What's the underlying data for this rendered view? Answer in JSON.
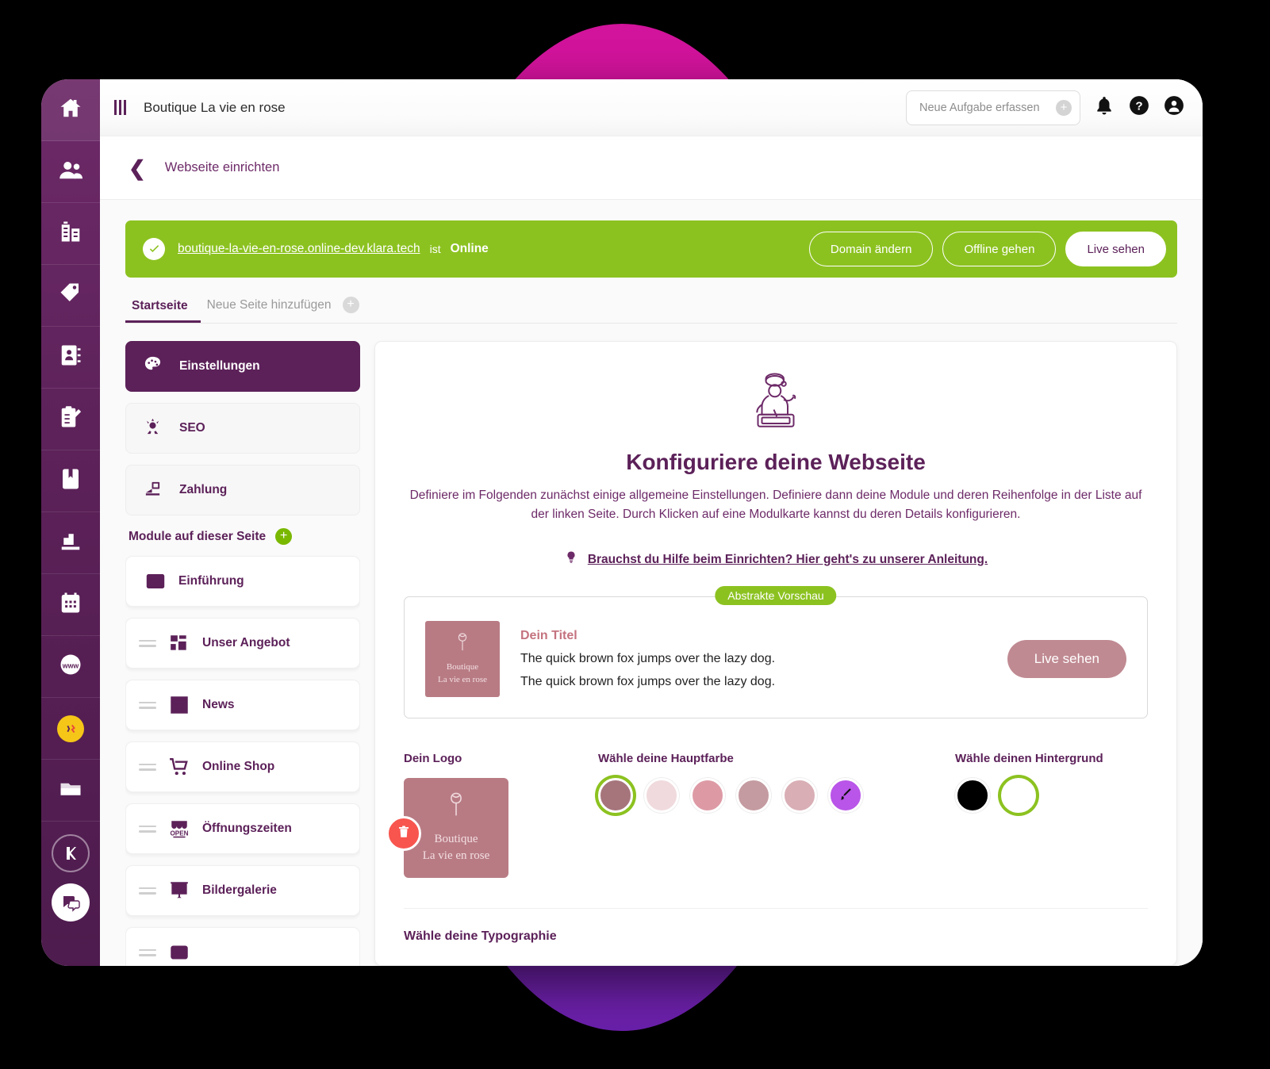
{
  "header": {
    "menu_icon": "hamburger-bars-icon",
    "app_title": "Boutique La vie en rose",
    "task_input_placeholder": "Neue Aufgabe erfassen",
    "task_add_icon": "plus-circle-icon",
    "bell_icon": "bell-icon",
    "help_icon": "question-circle-icon",
    "account_icon": "user-circle-icon"
  },
  "breadcrumb": {
    "back_icon": "chevron-left-icon",
    "label": "Webseite einrichten"
  },
  "banner": {
    "check_icon": "check-circle-icon",
    "url": "boutique-la-vie-en-rose.online-dev.klara.tech",
    "connector": "ist",
    "status": "Online",
    "buttons": [
      {
        "label": "Domain ändern",
        "style": "outline"
      },
      {
        "label": "Offline gehen",
        "style": "outline"
      },
      {
        "label": "Live sehen",
        "style": "solid"
      }
    ],
    "color": "#8cc220"
  },
  "tabs": [
    {
      "label": "Startseite",
      "active": true
    },
    {
      "label": "Neue Seite hinzufügen",
      "active": false,
      "icon": "plus-circle-icon"
    }
  ],
  "left_panel": {
    "nav": [
      {
        "label": "Einstellungen",
        "icon": "palette-icon",
        "selected": true
      },
      {
        "label": "SEO",
        "icon": "seo-rocket-icon",
        "selected": false
      },
      {
        "label": "Zahlung",
        "icon": "payment-icon",
        "selected": false
      }
    ],
    "modules_heading": "Module auf dieser Seite",
    "modules_add_icon": "plus-circle-green-icon",
    "modules": [
      {
        "label": "Einführung",
        "icon": "article-intro-icon",
        "draggable": false
      },
      {
        "label": "Unser Angebot",
        "icon": "grid-blocks-icon",
        "draggable": true
      },
      {
        "label": "News",
        "icon": "newspaper-icon",
        "draggable": true
      },
      {
        "label": "Online Shop",
        "icon": "shopping-cart-icon",
        "draggable": true
      },
      {
        "label": "Öffnungszeiten",
        "icon": "open-shop-icon",
        "draggable": true
      },
      {
        "label": "Bildergalerie",
        "icon": "image-gallery-icon",
        "draggable": true
      }
    ]
  },
  "main": {
    "hero_icon": "worker-tablet-illustration",
    "title": "Konfiguriere deine Webseite",
    "paragraph1": "Definiere im Folgenden zunächst einige allgemeine Einstellungen. Definiere dann deine Module und deren Reihenfolge in der Liste auf",
    "paragraph2": "der linken Seite. Durch Klicken auf eine Modulkarte kannst du deren Details konfigurieren.",
    "help_icon": "lightbulb-icon",
    "help_link": "Brauchst du Hilfe beim Einrichten? Hier geht's zu unserer Anleitung.",
    "preview": {
      "badge": "Abstrakte Vorschau",
      "logo_icon": "rose-outline-icon",
      "logo_line1": "Boutique",
      "logo_line2": "La vie en rose",
      "title": "Dein Titel",
      "line1": "The quick brown fox jumps over the lazy dog.",
      "line2": "The quick brown fox jumps over the lazy dog.",
      "button": "Live sehen",
      "button_color": "#c08a92",
      "logo_bg": "#b87b84"
    },
    "pickers": {
      "logo_label": "Dein Logo",
      "logo_icon": "rose-outline-icon",
      "logo_line1": "Boutique",
      "logo_line2": "La vie en rose",
      "logo_delete_icon": "trash-icon",
      "main_color_label": "Wähle deine Hauptfarbe",
      "main_colors": [
        {
          "hex": "#a6757c",
          "selected": true
        },
        {
          "hex": "#f0dadd",
          "selected": false
        },
        {
          "hex": "#dd9aa5",
          "selected": false
        },
        {
          "hex": "#c49ba0",
          "selected": false
        },
        {
          "hex": "#d9aeb5",
          "selected": false
        },
        {
          "hex": "#b955e8",
          "selected": false,
          "custom": true,
          "icon": "brush-icon"
        }
      ],
      "background_label": "Wähle deinen Hintergrund",
      "backgrounds": [
        {
          "hex": "#000000",
          "selected": false
        },
        {
          "hex": "#ffffff",
          "selected": true
        }
      ],
      "selection_ring_color": "#8cc220"
    },
    "typography_label": "Wähle deine Typographie"
  },
  "rail": {
    "items": [
      {
        "icon": "home-icon",
        "name": "home"
      },
      {
        "icon": "contacts-people-icon",
        "name": "contacts"
      },
      {
        "icon": "company-building-icon",
        "name": "company"
      },
      {
        "icon": "tag-icon",
        "name": "products"
      },
      {
        "icon": "address-book-icon",
        "name": "addressbook"
      },
      {
        "icon": "clipboard-edit-icon",
        "name": "tasks"
      },
      {
        "icon": "book-icon",
        "name": "journal"
      },
      {
        "icon": "chart-stairs-icon",
        "name": "reports"
      },
      {
        "icon": "calendar-icon",
        "name": "calendar"
      },
      {
        "icon": "globe-www-icon",
        "name": "website"
      },
      {
        "icon": "smiley-badge-icon",
        "name": "promo"
      },
      {
        "icon": "folder-icon",
        "name": "documents"
      }
    ],
    "brand_icon": "klara-k-logo-icon",
    "chat_icon": "chat-bubbles-icon",
    "color": "#5c2159"
  }
}
